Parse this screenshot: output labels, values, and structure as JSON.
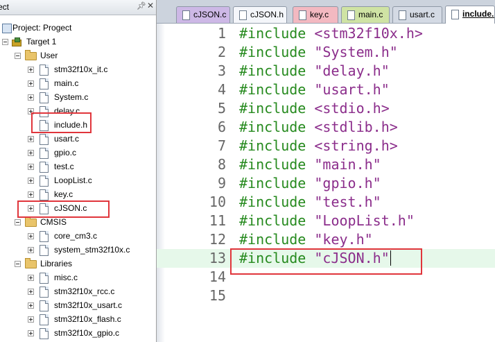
{
  "project_panel": {
    "title": "ect",
    "pin_icon": "pin-icon",
    "close_icon": "close-icon",
    "project_label": "Project: Progect",
    "target_label": "Target 1",
    "groups": [
      {
        "name": "User",
        "files": [
          "stm32f10x_it.c",
          "main.c",
          "System.c",
          "delay.c",
          "include.h",
          "usart.c",
          "gpio.c",
          "test.c",
          "LoopList.c",
          "key.c",
          "cJSON.c"
        ]
      },
      {
        "name": "CMSIS",
        "files": [
          "core_cm3.c",
          "system_stm32f10x.c"
        ]
      },
      {
        "name": "Libraries",
        "files": [
          "misc.c",
          "stm32f10x_rcc.c",
          "stm32f10x_usart.c",
          "stm32f10x_flash.c",
          "stm32f10x_gpio.c"
        ]
      }
    ]
  },
  "editor": {
    "tabs": [
      {
        "label": "cJSON.c",
        "color": "#cdb8e6"
      },
      {
        "label": "cJSON.h",
        "color": "#f4f6fa"
      },
      {
        "label": "key.c",
        "color": "#f3b9c1"
      },
      {
        "label": "main.c",
        "color": "#cfe3a4"
      },
      {
        "label": "usart.c",
        "color": "#d4dae4"
      },
      {
        "label": "include.h",
        "color": "#ffffff"
      }
    ],
    "active_tab": "include.h",
    "lines": [
      {
        "number": "1",
        "keyword": "#include",
        "target": "<stm32f10x.h>"
      },
      {
        "number": "2",
        "keyword": "#include",
        "target": "\"System.h\""
      },
      {
        "number": "3",
        "keyword": "#include",
        "target": "\"delay.h\""
      },
      {
        "number": "4",
        "keyword": "#include",
        "target": "\"usart.h\""
      },
      {
        "number": "5",
        "keyword": "#include",
        "target": "<stdio.h>"
      },
      {
        "number": "6",
        "keyword": "#include",
        "target": "<stdlib.h>"
      },
      {
        "number": "7",
        "keyword": "#include",
        "target": "<string.h>"
      },
      {
        "number": "8",
        "keyword": "#include",
        "target": "\"main.h\""
      },
      {
        "number": "9",
        "keyword": "#include",
        "target": "\"gpio.h\""
      },
      {
        "number": "10",
        "keyword": "#include",
        "target": "\"test.h\""
      },
      {
        "number": "11",
        "keyword": "#include",
        "target": "\"LoopList.h\""
      },
      {
        "number": "12",
        "keyword": "#include",
        "target": "\"key.h\""
      },
      {
        "number": "13",
        "keyword": "#include",
        "target": "\"cJSON.h\""
      },
      {
        "number": "14",
        "keyword": "",
        "target": ""
      },
      {
        "number": "15",
        "keyword": "",
        "target": ""
      }
    ],
    "current_line": "13",
    "colors": {
      "keyword": "#268a1e",
      "string": "#8b2d8b",
      "current_line_bg": "#e6f8ea",
      "highlight_box": "#e0353b"
    }
  }
}
